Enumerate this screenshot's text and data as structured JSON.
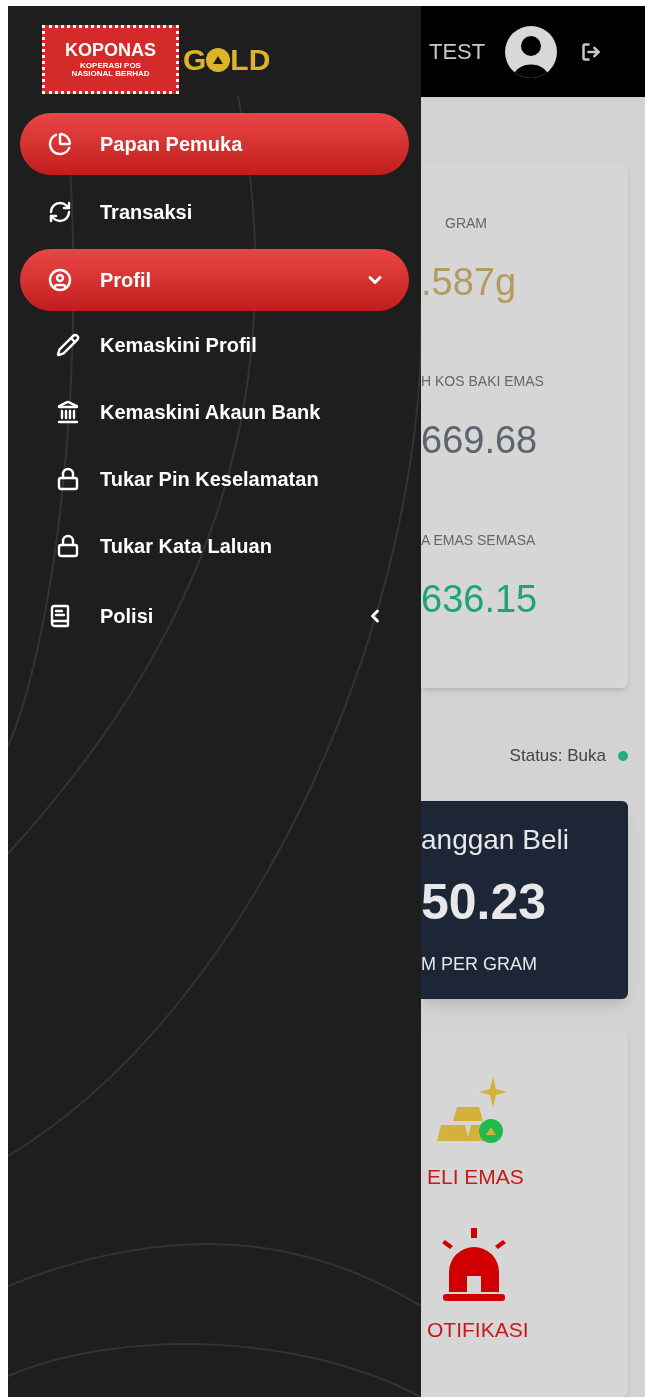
{
  "logo": {
    "title": "KOPONAS",
    "subtitle_1": "KOPERASI POS",
    "subtitle_2": "NASIONAL BERHAD",
    "brand_start": "G",
    "brand_end": "LD"
  },
  "menu": [
    {
      "kind": "link",
      "label": "Papan Pemuka",
      "selected": true
    },
    {
      "kind": "link",
      "label": "Transaksi",
      "selected": false
    },
    {
      "kind": "group",
      "label": "Profil",
      "selected": true,
      "expanded": true,
      "children": [
        {
          "label": "Kemaskini Profil"
        },
        {
          "label": "Kemaskini Akaun Bank"
        },
        {
          "label": "Tukar Pin Keselamatan"
        },
        {
          "label": "Tukar Kata Laluan"
        }
      ]
    },
    {
      "kind": "group",
      "label": "Polisi",
      "selected": false,
      "expanded": false
    }
  ],
  "top_bar": {
    "user_name": "TEST"
  },
  "summary_card": {
    "rows": [
      {
        "label": "GRAM",
        "value": ".587g",
        "color": "#b39a5e"
      },
      {
        "label": "H KOS BAKI EMAS",
        "value": "669.68",
        "color": "#5c6470"
      },
      {
        "label": "A EMAS SEMASA",
        "value": "636.15",
        "color": "#1fa37b"
      }
    ]
  },
  "status": {
    "text": "Status: Buka",
    "color": "#1fae7e"
  },
  "price_card": {
    "title": "anggan Beli",
    "price": "50.23",
    "unit": "M PER GRAM"
  },
  "actions": [
    {
      "label": "ELI EMAS"
    },
    {
      "label": "OTIFIKASI"
    }
  ]
}
